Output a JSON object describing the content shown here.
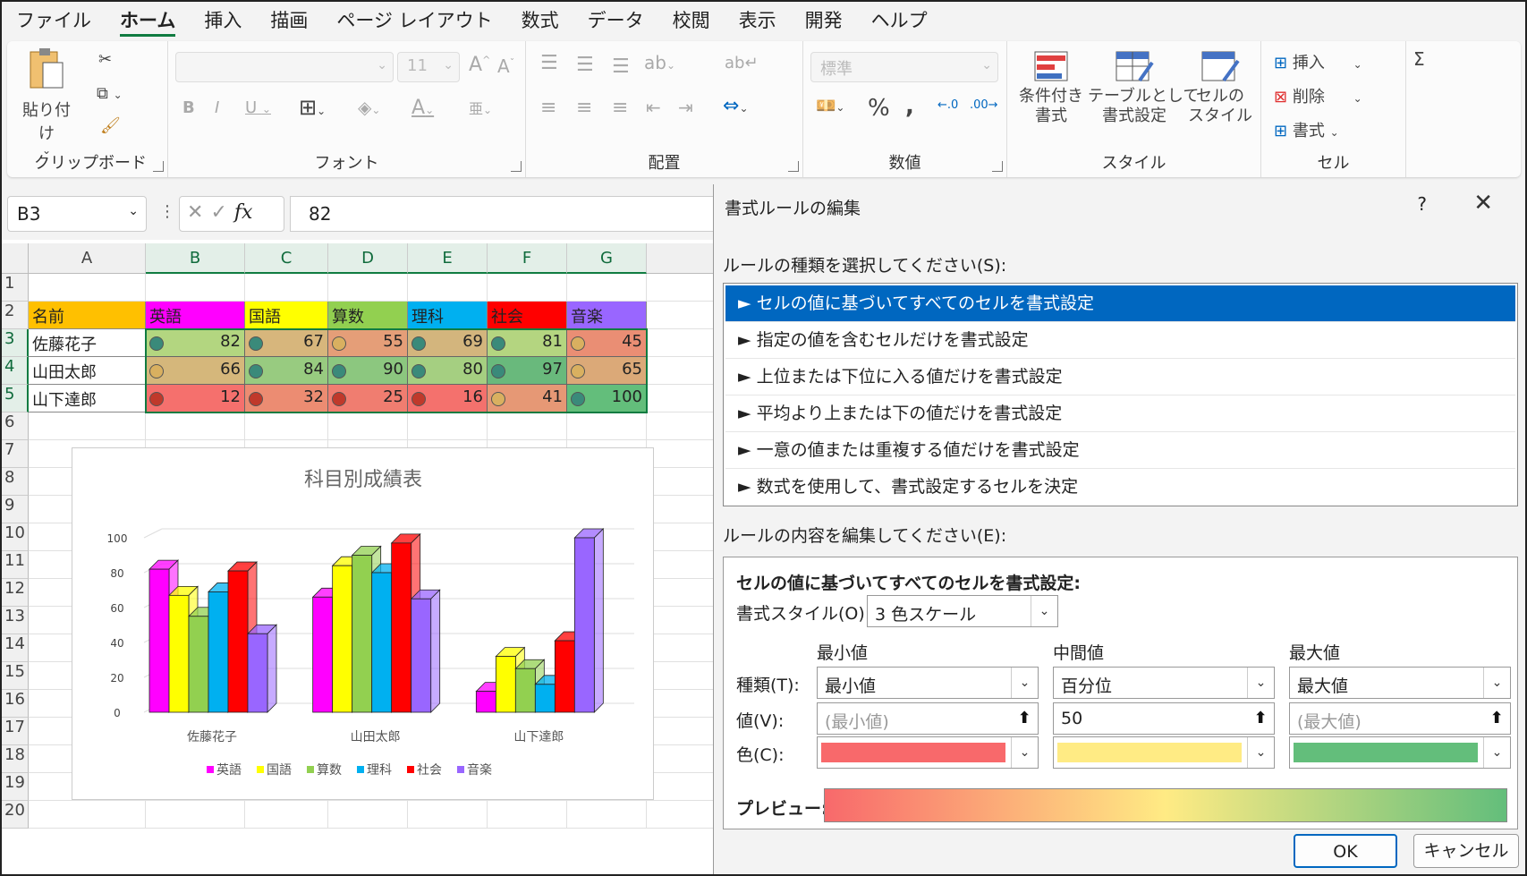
{
  "menu": [
    "ファイル",
    "ホーム",
    "挿入",
    "描画",
    "ページ レイアウト",
    "数式",
    "データ",
    "校閲",
    "表示",
    "開発",
    "ヘルプ"
  ],
  "ribbon": {
    "clipboard": {
      "label": "クリップボード",
      "paste": "貼り付け"
    },
    "font": {
      "label": "フォント",
      "size": "11"
    },
    "align": {
      "label": "配置"
    },
    "number": {
      "label": "数値",
      "format": "標準"
    },
    "style": {
      "label": "スタイル",
      "cond": "条件付き\n書式",
      "table": "テーブルとして\n書式設定",
      "cell": "セルの\nスタイル"
    },
    "cells": {
      "label": "セル",
      "insert": "挿入",
      "delete": "削除",
      "format": "書式"
    }
  },
  "formula": {
    "namebox": "B3",
    "fx": "fx",
    "value": "82"
  },
  "sheet": {
    "columns": [
      "A",
      "B",
      "C",
      "D",
      "E",
      "F",
      "G"
    ],
    "rows": [
      "1",
      "2",
      "3",
      "4",
      "5",
      "6",
      "7",
      "8",
      "9",
      "10",
      "11",
      "12",
      "13",
      "14",
      "15",
      "16",
      "17",
      "18",
      "19",
      "20"
    ],
    "headers": [
      "名前",
      "英語",
      "国語",
      "算数",
      "理科",
      "社会",
      "音楽"
    ],
    "header_colors": [
      "#ffc000",
      "#ff00ff",
      "#ffff00",
      "#92d050",
      "#00b0f0",
      "#ff0000",
      "#9966ff"
    ],
    "data": [
      {
        "name": "佐藤花子",
        "values": [
          82,
          67,
          55,
          69,
          81,
          45
        ]
      },
      {
        "name": "山田太郎",
        "values": [
          66,
          84,
          90,
          80,
          97,
          65
        ]
      },
      {
        "name": "山下達郎",
        "values": [
          12,
          32,
          25,
          16,
          41,
          100
        ]
      }
    ],
    "cell_colors": [
      [
        "#b3d680",
        "#d7b67c",
        "#e59e78",
        "#d3b57d",
        "#b4d580",
        "#ea8e74"
      ],
      [
        "#d5b77b",
        "#98cb80",
        "#8cc77f",
        "#a5cf81",
        "#69b97c",
        "#dba978"
      ],
      [
        "#f5706d",
        "#ec8c72",
        "#f07d70",
        "#f4716d",
        "#e69875",
        "#63be7b"
      ]
    ]
  },
  "chart_data": {
    "type": "bar",
    "title": "科目別成績表",
    "categories": [
      "佐藤花子",
      "山田太郎",
      "山下達郎"
    ],
    "series": [
      {
        "name": "英語",
        "values": [
          82,
          66,
          12
        ],
        "color": "#ff00ff"
      },
      {
        "name": "国語",
        "values": [
          67,
          84,
          32
        ],
        "color": "#ffff00"
      },
      {
        "name": "算数",
        "values": [
          55,
          90,
          25
        ],
        "color": "#92d050"
      },
      {
        "name": "理科",
        "values": [
          69,
          80,
          16
        ],
        "color": "#00b0f0"
      },
      {
        "name": "社会",
        "values": [
          81,
          97,
          41
        ],
        "color": "#ff0000"
      },
      {
        "name": "音楽",
        "values": [
          45,
          65,
          100
        ],
        "color": "#9966ff"
      }
    ],
    "yticks": [
      "100",
      "80",
      "60",
      "40",
      "20",
      "0"
    ],
    "ylim": [
      0,
      100
    ],
    "legend": "bottom"
  },
  "dialog": {
    "title": "書式ルールの編集",
    "help": "?",
    "close": "✕",
    "select_label": "ルールの種類を選択してください(S):",
    "rules": [
      "► セルの値に基づいてすべてのセルを書式設定",
      "► 指定の値を含むセルだけを書式設定",
      "► 上位または下位に入る値だけを書式設定",
      "► 平均より上または下の値だけを書式設定",
      "► 一意の値または重複する値だけを書式設定",
      "► 数式を使用して、書式設定するセルを決定"
    ],
    "edit_label": "ルールの内容を編集してください(E):",
    "edit_heading": "セルの値に基づいてすべてのセルを書式設定:",
    "style_label": "書式スタイル(O):",
    "style_value": "3 色スケール",
    "col_min": "最小値",
    "col_mid": "中間値",
    "col_max": "最大値",
    "type_label": "種類(T):",
    "value_label": "値(V):",
    "color_label": "色(C):",
    "min_type": "最小値",
    "mid_type": "百分位",
    "max_type": "最大値",
    "min_value_ph": "(最小値)",
    "mid_value": "50",
    "max_value_ph": "(最大値)",
    "min_color": "#f8696b",
    "mid_color": "#ffeb84",
    "max_color": "#63be7b",
    "preview_label": "プレビュー:",
    "ok": "OK",
    "cancel": "キャンセル"
  }
}
